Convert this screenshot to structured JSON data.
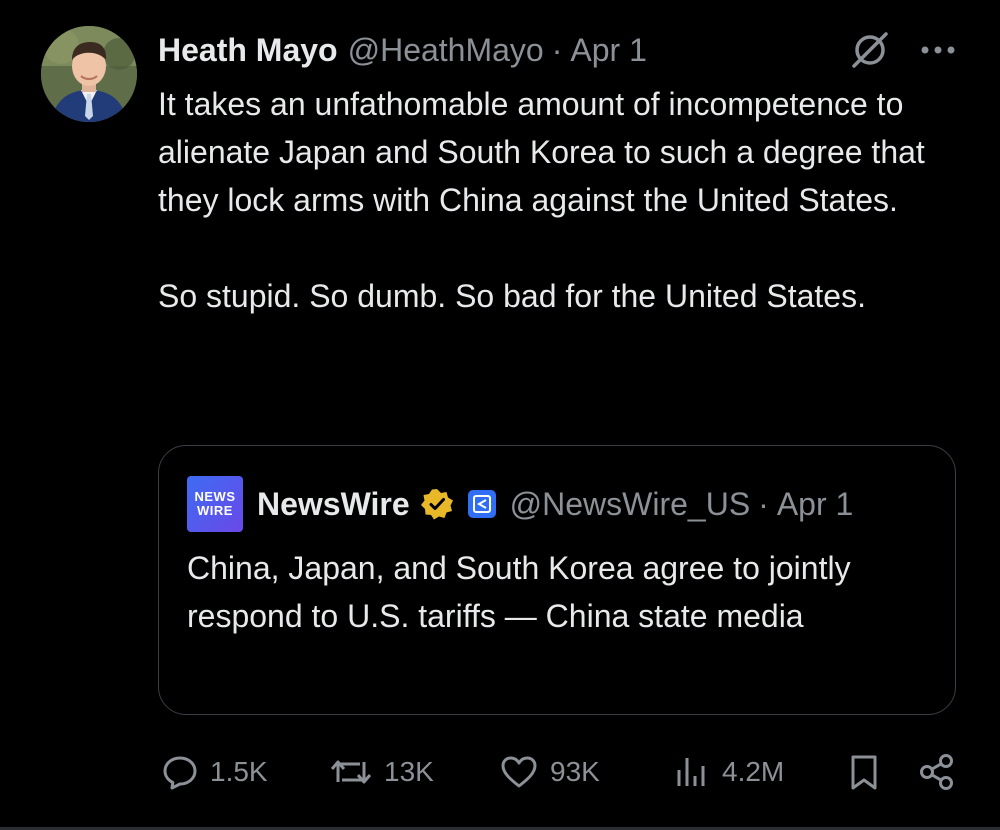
{
  "tweet": {
    "author_name": "Heath Mayo",
    "author_handle": "@HeathMayo",
    "separator": "·",
    "date": "Apr 1",
    "paragraphs": [
      "It takes an unfathomable amount of incompetence to alienate Japan and South Korea to such a degree that they lock arms with China against the United States.",
      "So stupid. So dumb. So bad for the United States."
    ]
  },
  "quote": {
    "logo_line1": "NEWS",
    "logo_line2": "WIRE",
    "name": "NewsWire",
    "handle": "@NewsWire_US",
    "separator": "·",
    "date": "Apr 1",
    "text": "China, Japan, and South Korea agree to jointly respond to U.S. tariffs — China state media"
  },
  "actions": {
    "replies": "1.5K",
    "reposts": "13K",
    "likes": "93K",
    "views": "4.2M"
  },
  "icons": {
    "header": [
      "grok-icon",
      "more-icon"
    ],
    "actions": [
      "reply-icon",
      "repost-icon",
      "like-icon",
      "views-icon",
      "bookmark-icon",
      "share-icon"
    ],
    "badges": [
      "verified-gold-icon",
      "affiliate-icon"
    ]
  },
  "colors": {
    "background": "#000000",
    "text": "#e7e9ea",
    "muted": "#8b9197",
    "border": "#3a3e43",
    "verified_gold": "#e8b829",
    "affiliate_blue": "#2f6ef5"
  }
}
